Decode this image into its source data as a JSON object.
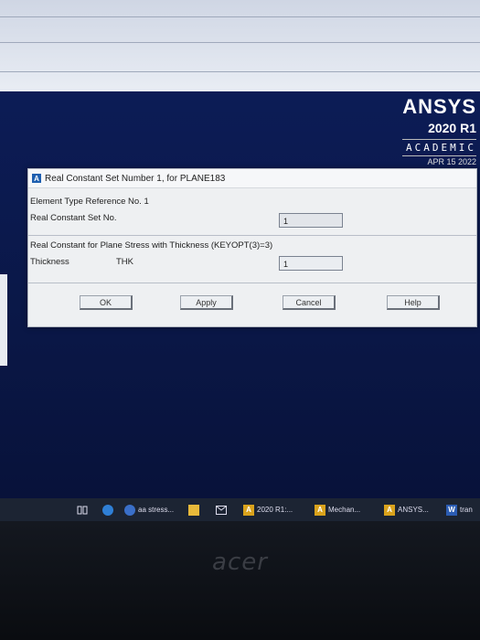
{
  "logo": {
    "brand": "ANSYS",
    "version": "2020 R1",
    "edition": "ACADEMIC",
    "date": "APR 15 2022"
  },
  "dialog": {
    "icon_letter": "A",
    "title": "Real Constant Set Number 1, for PLANE183",
    "element_type_label": "Element Type Reference No. 1",
    "real_set_label": "Real Constant Set No.",
    "real_set_value": "1",
    "section_label": "Real Constant for Plane Stress with Thickness (KEYOPT(3)=3)",
    "thickness_label": "Thickness",
    "thickness_key": "THK",
    "thickness_value": "1",
    "buttons": {
      "ok": "OK",
      "apply": "Apply",
      "cancel": "Cancel",
      "help": "Help"
    }
  },
  "taskbar": {
    "items": [
      {
        "label": "aa stress..."
      },
      {
        "label": "2020 R1:..."
      },
      {
        "label": "Mechan..."
      },
      {
        "label": "ANSYS..."
      },
      {
        "label": "tran"
      }
    ]
  },
  "bezel": {
    "brand": "acer"
  }
}
